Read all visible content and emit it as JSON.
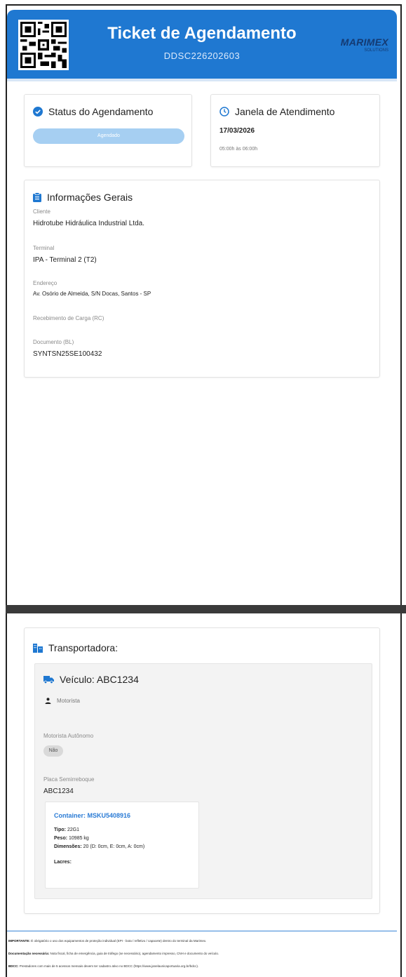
{
  "header": {
    "title": "Ticket de Agendamento",
    "code": "DDSC226202603",
    "logo_text": "MARIMEX",
    "logo_sub": "SOLUTIONS"
  },
  "status": {
    "title": "Status do Agendamento",
    "value": "Agendado"
  },
  "window": {
    "title": "Janela de Atendimento",
    "date": "17/03/2026",
    "time": "05:00h às 06:00h"
  },
  "info": {
    "title": "Informações Gerais",
    "fields": [
      {
        "label": "Cliente",
        "value": "Hidrotube Hidráulica Industrial Ltda."
      },
      {
        "label": "Terminal",
        "value": "IPA - Terminal 2 (T2)"
      },
      {
        "label": "Endereço",
        "value": "Av. Osório de Almeida, S/N Docas, Santos - SP"
      },
      {
        "label": "Recebimento de Carga (RC)",
        "value": ""
      },
      {
        "label": "Documento (BL)",
        "value": "SYNTSN25SE100432"
      }
    ]
  },
  "transport": {
    "title": "Transportadora:",
    "vehicle_title": "Veículo: ABC1234",
    "driver_label": "Motorista",
    "autonomo_label": "Motorista Autônomo",
    "autonomo_value": "Não",
    "plate_label": "Placa Semirreboque",
    "plate_value": "ABC1234",
    "container": {
      "title": "Container: MSKU5408916",
      "tipo_label": "Tipo:",
      "tipo_value": "22G1",
      "peso_label": "Peso:",
      "peso_value": "10985 kg",
      "dim_label": "Dimensões:",
      "dim_value": "20 (D: 0cm, E: 0cm, A: 0cm)",
      "lacres_label": "Lacres:"
    }
  },
  "footer": {
    "important_label": "IMPORTANTE:",
    "important_text": "É obrigatório o uso dos equipamentos de proteção individual (EPI - bota / refletivo / capacete) dentro do terminal da Marimex.",
    "docs_label": "Documentação necessária:",
    "docs_text": "Nota fiscal, ficha de emergência, guia de tráfego (se necessário), agendamento impresso, CNH e documento do veículo.",
    "bdcc_label": "BDCC:",
    "bdcc_text": "Prestadores com mais de 5 acessos mensais devem ter cadastro ativo no BDCC (https://www.janelaunicaportuaria.org.br/bdcc)."
  },
  "colors": {
    "primary": "#1f78d1",
    "status_pill": "#a6cff2",
    "link": "#2a7bd5"
  }
}
